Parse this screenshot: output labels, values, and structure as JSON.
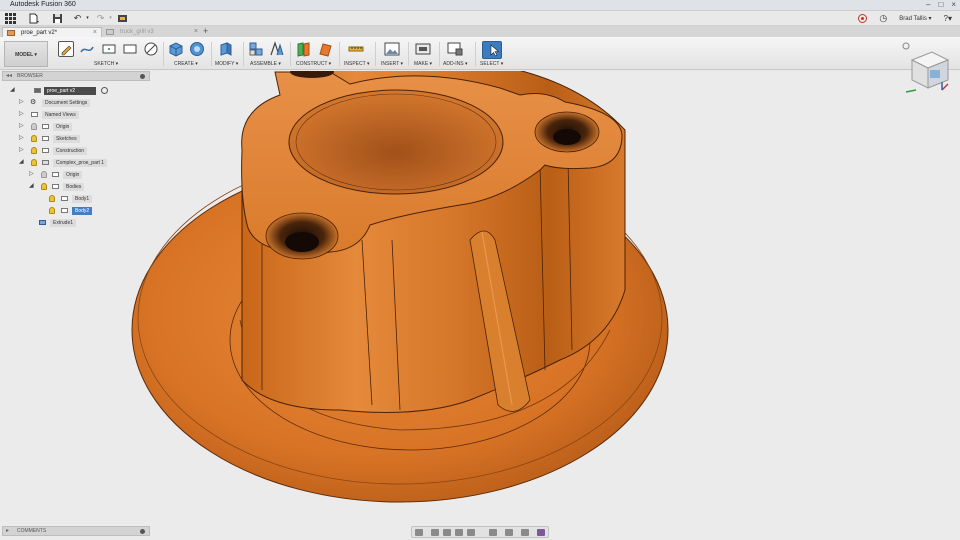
{
  "app": {
    "title": "Autodesk Fusion 360"
  },
  "quick_access": {
    "user_name": "Brad Tallis"
  },
  "tabs": [
    {
      "label": "proe_part v2*",
      "active": true
    },
    {
      "label": "truck_grill v3",
      "active": false
    }
  ],
  "toolbar": {
    "workspace": "MODEL",
    "groups": [
      {
        "label": "SKETCH"
      },
      {
        "label": "CREATE"
      },
      {
        "label": "MODIFY"
      },
      {
        "label": "ASSEMBLE"
      },
      {
        "label": "CONSTRUCT"
      },
      {
        "label": "INSPECT"
      },
      {
        "label": "INSERT"
      },
      {
        "label": "MAKE"
      },
      {
        "label": "ADD-INS"
      },
      {
        "label": "SELECT"
      }
    ]
  },
  "browser": {
    "header": "BROWSER",
    "root": "proe_part v2",
    "nodes": [
      {
        "label": "Document Settings"
      },
      {
        "label": "Named Views"
      },
      {
        "label": "Origin"
      },
      {
        "label": "Sketches"
      },
      {
        "label": "Construction"
      },
      {
        "label": "Complex_proe_part 1"
      },
      {
        "label": "Origin"
      },
      {
        "label": "Bodies"
      },
      {
        "label": "Body1"
      },
      {
        "label": "Body2"
      },
      {
        "label": "Extrude1"
      }
    ]
  },
  "comments": {
    "header": "COMMENTS"
  },
  "colors": {
    "part": "#d9782c",
    "selection": "#3f7fc4",
    "workspace_bg": "#ebebeb"
  }
}
